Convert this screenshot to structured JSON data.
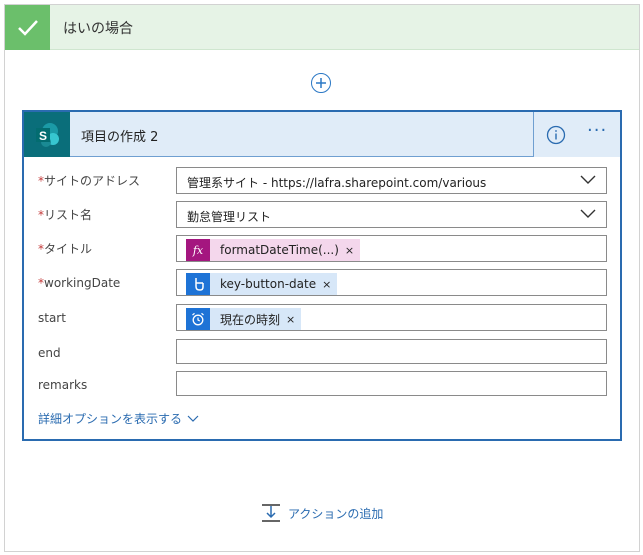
{
  "yes_branch": {
    "title": "はいの場合"
  },
  "card": {
    "title": "項目の作成 2",
    "fields": [
      {
        "label": "サイトのアドレス",
        "required": true,
        "value": "管理系サイト - https://lafra.sharepoint.com/various",
        "kind": "dropdown"
      },
      {
        "label": "リスト名",
        "required": true,
        "value": "勤怠管理リスト",
        "kind": "dropdown"
      },
      {
        "label": "タイトル",
        "required": true,
        "token": "formatDateTime(...)",
        "token_kind": "expression"
      },
      {
        "label": "workingDate",
        "required": true,
        "token": "key-button-date",
        "token_kind": "button-trigger"
      },
      {
        "label": "start",
        "required": false,
        "token": "現在の時刻",
        "token_kind": "date-time"
      },
      {
        "label": "end",
        "required": false,
        "value": ""
      },
      {
        "label": "remarks",
        "required": false,
        "value": ""
      }
    ],
    "required_marker": "*",
    "token_remove": "×",
    "advanced_link": "詳細オプションを表示する"
  },
  "add_action": {
    "label": "アクションの追加"
  },
  "colors": {
    "accent": "#2a6bb0",
    "yes_header_bg": "#e6f3e6",
    "check_green": "#6bbf6b",
    "sharepoint_teal": "#0a6e7a",
    "expression_purple": "#a4167f",
    "expression_token_bg": "#f4d7ec",
    "trigger_blue": "#1e73d6",
    "token_bg_blue": "#d7e7f8"
  }
}
